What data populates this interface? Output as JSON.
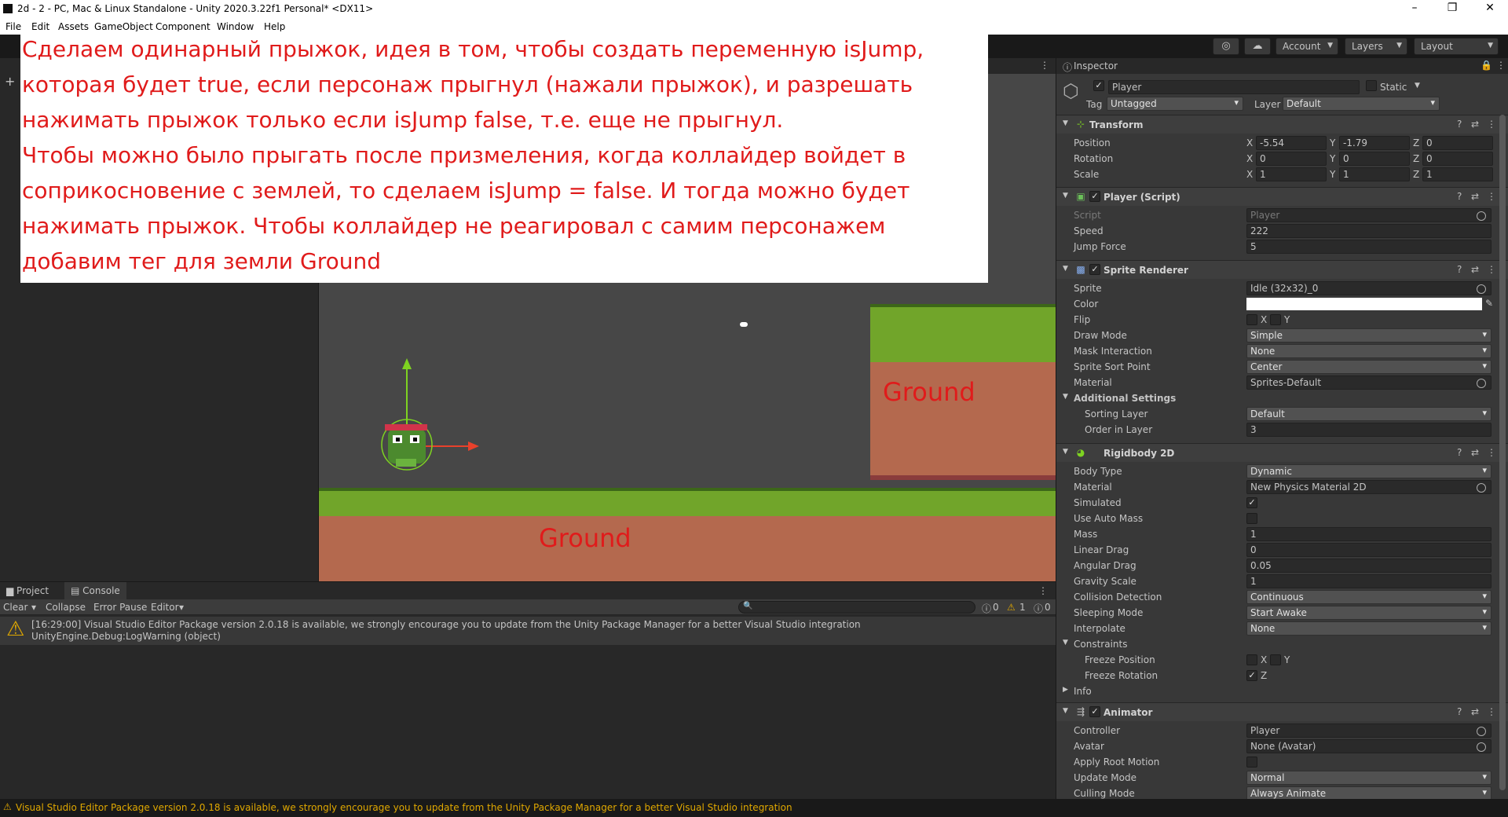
{
  "window": {
    "title": "2d - 2 - PC, Mac & Linux Standalone - Unity 2020.3.22f1 Personal* <DX11>",
    "controls": [
      "–",
      "❐",
      "✕"
    ]
  },
  "menu": [
    "File",
    "Edit",
    "Assets",
    "GameObject",
    "Component",
    "Window",
    "Help"
  ],
  "toolbar": {
    "account": "Account",
    "layers": "Layers",
    "layout": "Layout"
  },
  "overlay": {
    "lines": [
      "Сделаем одинарный прыжок, идея в том, чтобы создать переменную isJump,",
      "которая будет true, если персонаж прыгнул (нажали прыжок), и разрешать",
      "нажимать прыжок только если isJump false, т.е. еще не прыгнул.",
      "Чтобы можно было прыгать после призмеления, когда коллайдер войдет в",
      "соприкосновение с землей, то сделаем isJump = false. И тогда можно будет",
      "нажимать прыжок. Чтобы коллайдер не реагировал с самим персонажем",
      "добавим тег для земли Ground"
    ]
  },
  "scene": {
    "ground_label_1": "Ground",
    "ground_label_2": "Ground"
  },
  "bottom": {
    "tabs": [
      "Project",
      "Console"
    ],
    "buttons": {
      "clear": "Clear",
      "collapse": "Collapse",
      "error_pause": "Error Pause",
      "editor": "Editor"
    },
    "counts": {
      "info": "0",
      "warn": "1",
      "error": "0"
    },
    "log": {
      "line1": "[16:29:00] Visual Studio Editor Package version 2.0.18 is available, we strongly encourage you to update from the Unity Package Manager for a better Visual Studio integration",
      "line2": "UnityEngine.Debug:LogWarning (object)"
    }
  },
  "status": "Visual Studio Editor Package version 2.0.18 is available, we strongly encourage you to update from the Unity Package Manager for a better Visual Studio integration",
  "inspector": {
    "tab": "Inspector",
    "object_name": "Player",
    "static": "Static",
    "tag_label": "Tag",
    "tag": "Untagged",
    "layer_label": "Layer",
    "layer": "Default",
    "transform": {
      "title": "Transform",
      "position_label": "Position",
      "position": {
        "x": "-5.54",
        "y": "-1.79",
        "z": "0"
      },
      "rotation_label": "Rotation",
      "rotation": {
        "x": "0",
        "y": "0",
        "z": "0"
      },
      "scale_label": "Scale",
      "scale": {
        "x": "1",
        "y": "1",
        "z": "1"
      }
    },
    "script": {
      "title": "Player (Script)",
      "script_label": "Script",
      "script": "Player",
      "speed_label": "Speed",
      "speed": "222",
      "jump_label": "Jump Force",
      "jump": "5"
    },
    "sprite_renderer": {
      "title": "Sprite Renderer",
      "sprite_label": "Sprite",
      "sprite": "Idle (32x32)_0",
      "color_label": "Color",
      "flip_label": "Flip",
      "draw_mode_label": "Draw Mode",
      "draw_mode": "Simple",
      "mask_label": "Mask Interaction",
      "mask": "None",
      "sort_point_label": "Sprite Sort Point",
      "sort_point": "Center",
      "material_label": "Material",
      "material": "Sprites-Default",
      "additional": "Additional Settings",
      "sorting_layer_label": "Sorting Layer",
      "sorting_layer": "Default",
      "order_label": "Order in Layer",
      "order": "3"
    },
    "rigidbody": {
      "title": "Rigidbody 2D",
      "body_type_label": "Body Type",
      "body_type": "Dynamic",
      "material_label": "Material",
      "material": "New Physics Material 2D",
      "simulated_label": "Simulated",
      "auto_mass_label": "Use Auto Mass",
      "mass_label": "Mass",
      "mass": "1",
      "linear_drag_label": "Linear Drag",
      "linear_drag": "0",
      "angular_drag_label": "Angular Drag",
      "angular_drag": "0.05",
      "gravity_label": "Gravity Scale",
      "gravity": "1",
      "collision_label": "Collision Detection",
      "collision": "Continuous",
      "sleeping_label": "Sleeping Mode",
      "sleeping": "Start Awake",
      "interpolate_label": "Interpolate",
      "interpolate": "None",
      "constraints_label": "Constraints",
      "freeze_pos_label": "Freeze Position",
      "freeze_rot_label": "Freeze Rotation",
      "info_label": "Info"
    },
    "animator": {
      "title": "Animator",
      "controller_label": "Controller",
      "controller": "Player",
      "avatar_label": "Avatar",
      "avatar": "None (Avatar)",
      "root_motion_label": "Apply Root Motion",
      "update_mode_label": "Update Mode",
      "update_mode": "Normal",
      "culling_label": "Culling Mode",
      "culling": "Always Animate"
    },
    "axes": {
      "x": "X",
      "y": "Y",
      "z": "Z"
    }
  }
}
